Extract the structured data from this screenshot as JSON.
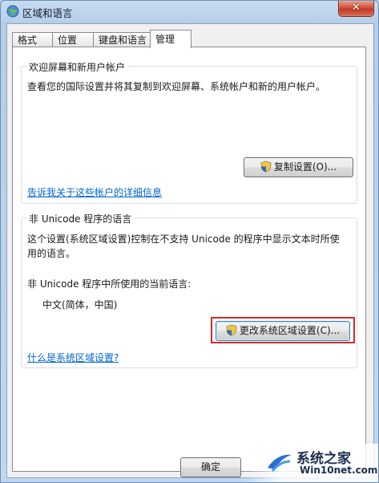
{
  "window": {
    "title": "区域和语言",
    "close_label": "✕"
  },
  "tabs": [
    {
      "label": "格式"
    },
    {
      "label": "位置"
    },
    {
      "label": "键盘和语言"
    },
    {
      "label": "管理"
    }
  ],
  "welcome_group": {
    "title": "欢迎屏幕和新用户帐户",
    "description": "查看您的国际设置并将其复制到欢迎屏幕、系统帐户和新的用户帐户。",
    "copy_button": "复制设置(O)...",
    "link": "告诉我关于这些帐户的详细信息"
  },
  "unicode_group": {
    "title": "非 Unicode 程序的语言",
    "description_line1": "这个设置(系统区域设置)控制在不支持 Unicode 的程序中显示文本时所使",
    "description_line2": "用的语言。",
    "current_label": "非 Unicode 程序中所使用的当前语言:",
    "current_value": "中文(简体，中国)",
    "change_button": "更改系统区域设置(C)...",
    "link": "什么是系统区域设置?"
  },
  "footer": {
    "ok_button": "确定"
  },
  "watermark": {
    "line1": "系统之家",
    "line2": "Win10net.com"
  },
  "colors": {
    "link": "#0066cc",
    "highlight": "#d52a2a",
    "title_bar": "#b9d1ea"
  }
}
